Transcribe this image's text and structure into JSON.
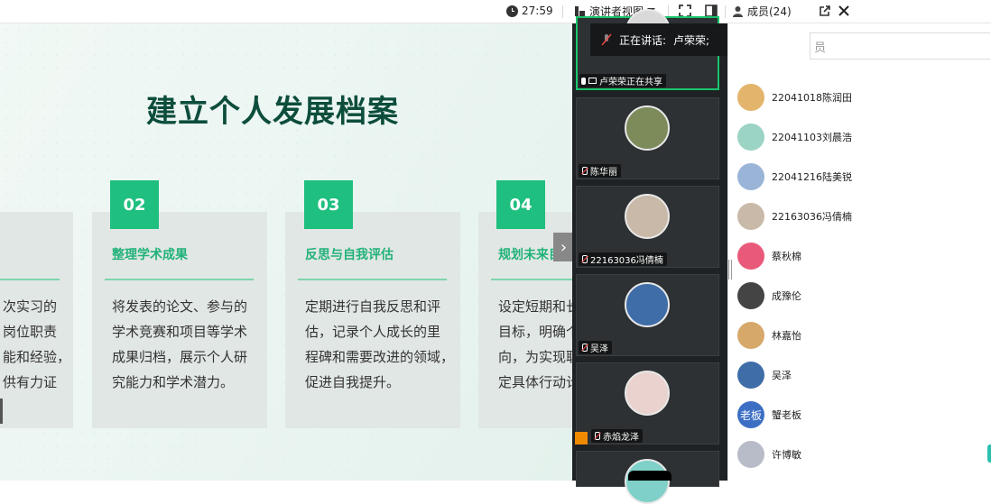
{
  "toolbar": {
    "timer": "27:59",
    "presenter_view_label": "演讲者视图",
    "members_label": "成员(24)"
  },
  "slide": {
    "title": "建立个人发展档案",
    "cards": [
      {
        "number": "",
        "heading": "",
        "lines": [
          "次实习的",
          "岗位职责",
          "能和经验，",
          "供有力证"
        ]
      },
      {
        "number": "02",
        "heading": "整理学术成果",
        "lines": [
          "将发表的论文、参与的",
          "学术竞赛和项目等学术",
          "成果归档，展示个人研",
          "究能力和学术潜力。"
        ]
      },
      {
        "number": "03",
        "heading": "反思与自我评估",
        "lines": [
          "定期进行自我反思和评",
          "估，记录个人成长的里",
          "程碑和需要改进的领域，",
          "促进自我提升。"
        ]
      },
      {
        "number": "04",
        "heading": "规划未来目标",
        "lines": [
          "设定短期和长",
          "目标，明确个",
          "向，为实现职",
          "定具体行动计"
        ]
      }
    ]
  },
  "speaking": {
    "label": "正在讲话:",
    "name": "卢荣荣;"
  },
  "videos": [
    {
      "name": "卢荣荣正在共享",
      "sharing": true,
      "active": true,
      "avatar_color": "#d9d9d9"
    },
    {
      "name": "陈华丽",
      "avatar_color": "#7d8a5a"
    },
    {
      "name": "22163036冯倩楠",
      "avatar_color": "#c9b9a8"
    },
    {
      "name": "吴泽",
      "avatar_color": "#3f6da8"
    },
    {
      "name": "赤焰龙泽",
      "avatar_color": "#ead3cf",
      "badge": true
    }
  ],
  "members": {
    "search_placeholder": "员",
    "list": [
      {
        "name": "22041018陈润田",
        "avatar_color": "#e3b46b"
      },
      {
        "name": "22041103刘晨浩",
        "avatar_color": "#9bd3c5"
      },
      {
        "name": "22041216陆美锐",
        "avatar_color": "#9ab4d8"
      },
      {
        "name": "22163036冯倩楠",
        "avatar_color": "#c9b9a8"
      },
      {
        "name": "蔡秋棉",
        "avatar_color": "#e95a7a"
      },
      {
        "name": "成豫伦",
        "avatar_color": "#444444"
      },
      {
        "name": "林嘉怡",
        "avatar_color": "#d6a86a"
      },
      {
        "name": "吴泽",
        "avatar_color": "#3f6da8"
      },
      {
        "name": "蟹老板",
        "avatar_text": "老板",
        "avatar_color": "#3c6fc4"
      },
      {
        "name": "许博敏",
        "avatar_color": "#b7bcc8"
      }
    ]
  }
}
